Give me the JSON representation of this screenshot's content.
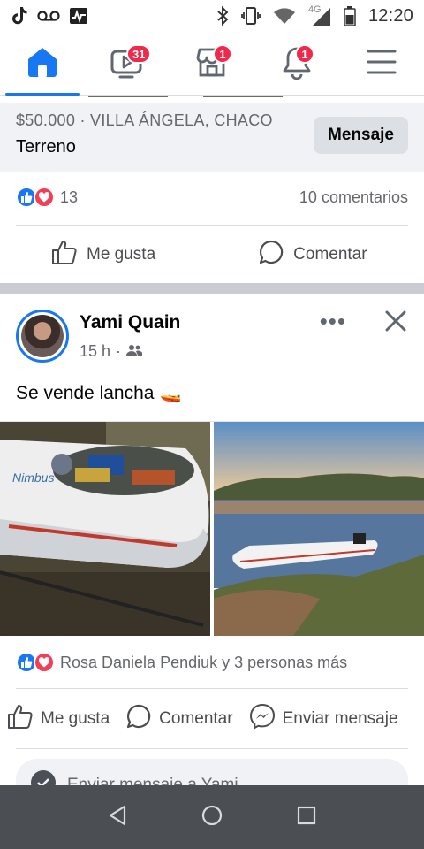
{
  "status_bar": {
    "time": "12:20",
    "network": "4G",
    "left_icons": [
      "tiktok-icon",
      "voicemail-icon",
      "activity-icon"
    ],
    "right_icons": [
      "bluetooth-icon",
      "vibrate-icon",
      "wifi-icon",
      "signal-icon",
      "battery-icon"
    ]
  },
  "nav": {
    "tabs": [
      {
        "name": "home",
        "icon": "home-icon",
        "active": true,
        "badge": ""
      },
      {
        "name": "watch",
        "icon": "video-icon",
        "active": false,
        "badge": "31"
      },
      {
        "name": "marketplace",
        "icon": "store-icon",
        "active": false,
        "badge": "1"
      },
      {
        "name": "notifications",
        "icon": "bell-icon",
        "active": false,
        "badge": "1"
      },
      {
        "name": "menu",
        "icon": "hamburger-icon",
        "active": false,
        "badge": ""
      }
    ]
  },
  "marketplace_item": {
    "price_location": "$50.000 · VILLA ÁNGELA, CHACO",
    "title": "Terreno",
    "message_button": "Mensaje"
  },
  "post1_stats": {
    "reaction_count": "13",
    "comments": "10 comentarios"
  },
  "post1_actions": {
    "like": "Me gusta",
    "comment": "Comentar"
  },
  "post2": {
    "author": "Yami Quain",
    "time": "15 h",
    "audience_icon": "friends-icon",
    "text": "Se vende lancha",
    "text_emoji": "🚤",
    "reactions_text": "Rosa Daniela Pendiuk y 3 personas más",
    "actions": {
      "like": "Me gusta",
      "comment": "Comentar",
      "send": "Enviar mensaje"
    },
    "comment_placeholder": "Enviar mensaje a Yami..."
  },
  "colors": {
    "brand_blue": "#1877f2",
    "badge_red": "#f02849",
    "love_red": "#f33e58",
    "secondary_text": "#65676b",
    "system_nav": "#4b4f53"
  }
}
